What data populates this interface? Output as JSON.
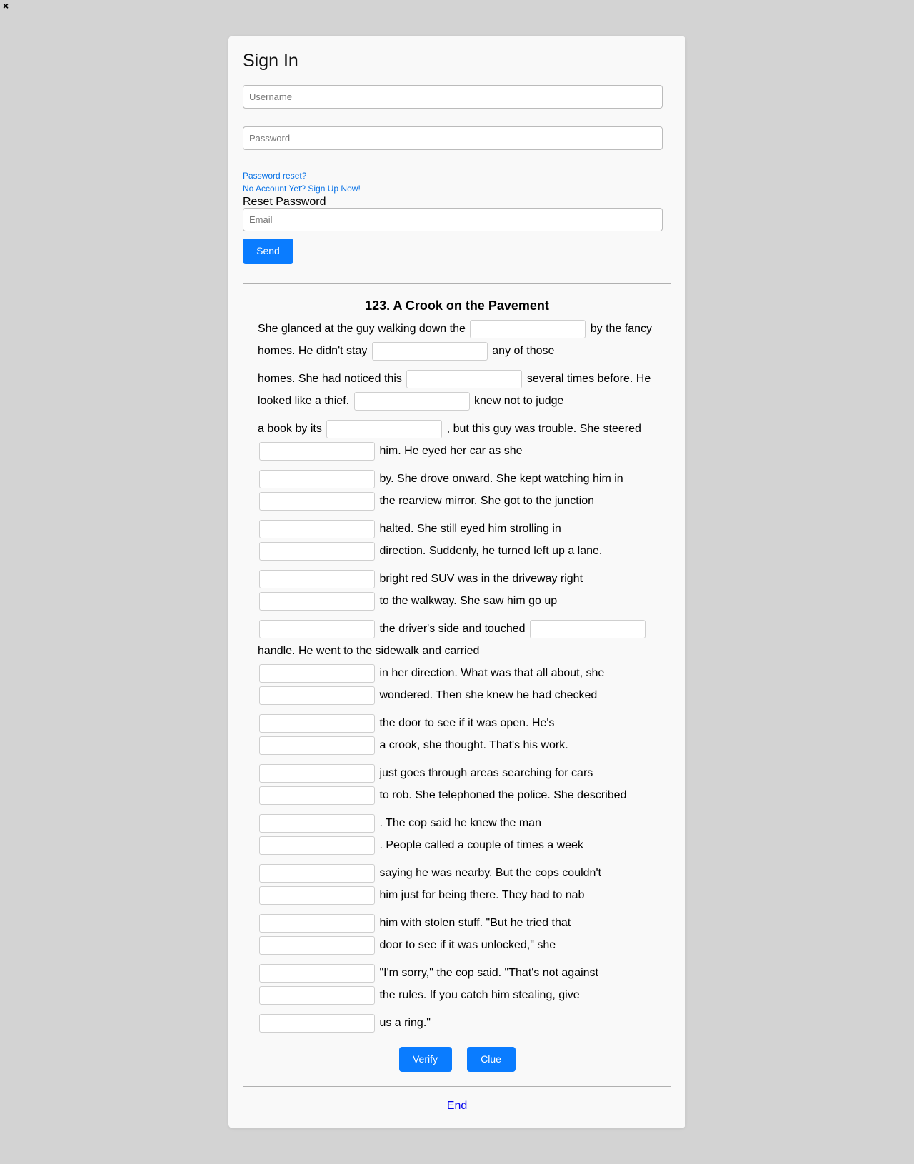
{
  "close_label": "×",
  "signin": {
    "title": "Sign In",
    "username_placeholder": "Username",
    "password_placeholder": "Password",
    "password_reset_link": "Password reset?",
    "signup_link": "No Account Yet? Sign Up Now!",
    "reset_title": "Reset Password",
    "email_placeholder": "Email",
    "send_label": "Send"
  },
  "exercise": {
    "title": "123. A Crook on the Pavement",
    "segments": [
      "She glanced at the guy walking down the",
      "by the fancy homes. He didn't stay",
      "any of those",
      "homes. She had noticed this",
      "several times before. He looked like a thief.",
      "knew not to judge",
      "a book by its",
      ", but this guy was trouble. She steered",
      "him. He eyed her car as she",
      "by. She drove onward. She kept watching him in",
      "the rearview mirror. She got to the junction",
      "halted. She still eyed him strolling in",
      "direction. Suddenly, he turned left up a lane.",
      "bright red SUV was in the driveway right",
      "to the walkway. She saw him go up",
      "the driver's side and touched",
      "handle. He went to the sidewalk and carried",
      "in her direction. What was that all about, she",
      "wondered. Then she knew he had checked",
      "the door to see if it was open. He's",
      "a crook, she thought. That's his work.",
      "just goes through areas searching for cars",
      "to rob. She telephoned the police. She described",
      ". The cop said he knew the man",
      ". People called a couple of times a week",
      "saying he was nearby. But the cops couldn't",
      "him just for being there. They had to nab",
      "him with stolen stuff. \"But he tried that",
      "door to see if it was unlocked,\" she",
      "\"I'm sorry,\" the cop said. \"That's not against",
      "the rules. If you catch him stealing, give",
      "us a ring.\""
    ],
    "verify_label": "Verify",
    "clue_label": "Clue"
  },
  "end_label": "End",
  "colors": {
    "background": "#d3d3d3",
    "card": "#f9f9f9",
    "primary_button": "#0a7cff",
    "link": "#0a73e6"
  }
}
